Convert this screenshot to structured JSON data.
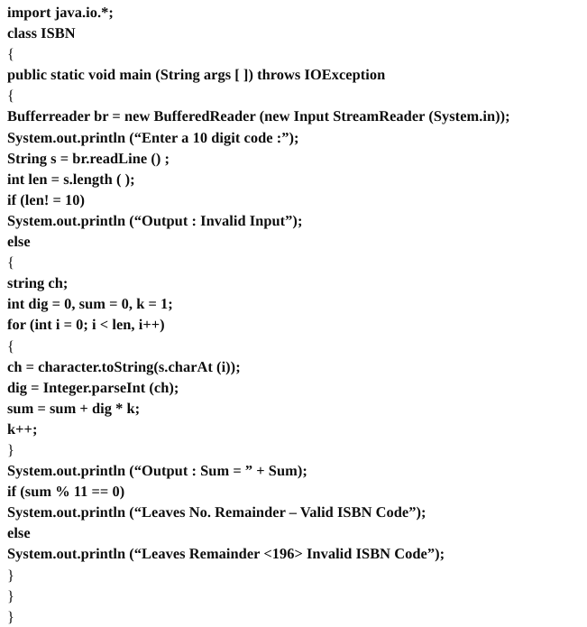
{
  "document": {
    "type": "scanned-code-listing",
    "language": "Java",
    "class_name": "ISBN",
    "background_color": "#ffffff",
    "text_color": "#0d0d0d"
  },
  "code": {
    "lines": [
      "import java.io.*;",
      "class ISBN",
      "{",
      "public static void main (String args [ ]) throws IOException",
      "{",
      "Bufferreader br = new BufferedReader (new Input StreamReader (System.in));",
      "System.out.println (“Enter a 10 digit code :”);",
      "String s = br.readLine () ;",
      "int len = s.length ( );",
      "if (len! = 10)",
      "System.out.println (“Output : Invalid Input”);",
      "else",
      "{",
      "string ch;",
      "int dig = 0, sum = 0, k = 1;",
      "for (int i = 0; i < len, i++)",
      "{",
      "ch = character.toString(s.charAt (i));",
      "dig = Integer.parseInt (ch);",
      "sum = sum + dig * k;",
      "k++;",
      "}",
      "System.out.println (“Output : Sum = ” + Sum);",
      "if (sum % 11 == 0)",
      "System.out.println (“Leaves No. Remainder – Valid ISBN Code”);",
      "else",
      "System.out.println (“Leaves Remainder <196> Invalid ISBN Code”);",
      "}",
      "}",
      "}"
    ]
  }
}
